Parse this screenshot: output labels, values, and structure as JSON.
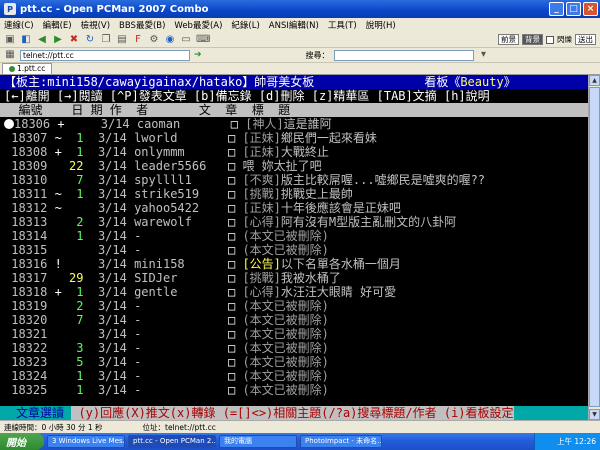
{
  "window": {
    "title": "ptt.cc - Open PCMan 2007 Combo"
  },
  "menu": [
    "連線(C)",
    "編輯(E)",
    "檢視(V)",
    "BBS最愛(B)",
    "Web最愛(A)",
    "紀錄(L)",
    "ANSI編輯(N)",
    "工具(T)",
    "說明(H)"
  ],
  "toolbar": {
    "btn1": "前景",
    "btn2": "背景",
    "checkbox_label": "閃爍",
    "select": "送出"
  },
  "address": {
    "value": "telnet://ptt.cc",
    "search_label": "搜尋："
  },
  "tab": {
    "label": "1.ptt.cc"
  },
  "terminal": {
    "header": {
      "left": "【板主:mini158/cawayigainax/hatako】",
      "board_title": "帥哥美女板",
      "right_prefix": "看板《",
      "board_name": "Beauty",
      "right_suffix": "》"
    },
    "hint": "[←]離開 [→]閱讀 [^P]發表文章 [b]備忘錄 [d]刪除 [z]精華區 [TAB]文摘 [h]說明",
    "columns": "  編號    日 期 作  者       文  章  標  題",
    "rows": [
      {
        "num": "18306",
        "mark": "+",
        "push": "",
        "date": "3/14",
        "author": "caoman",
        "cat": "[神人]",
        "title": "這是誰阿"
      },
      {
        "num": "18307",
        "mark": "~",
        "push": "1",
        "date": "3/14",
        "author": "lworld",
        "cat": "[正妹]",
        "title": "鄉民們一起來看妹"
      },
      {
        "num": "18308",
        "mark": "+",
        "push": "1",
        "date": "3/14",
        "author": "onlymmm",
        "cat": "[正妹]",
        "title": "大戰終止"
      },
      {
        "num": "18309",
        "mark": "",
        "push": "22",
        "date": "3/14",
        "author": "leader5566",
        "cat": "",
        "title": "喂 妳太扯了吧"
      },
      {
        "num": "18310",
        "mark": "",
        "push": "7",
        "date": "3/14",
        "author": "spyllll1",
        "cat": "[不爽]",
        "title": "版主比較屌喔...噓鄉民是噓爽的喔??"
      },
      {
        "num": "18311",
        "mark": "~",
        "push": "1",
        "date": "3/14",
        "author": "strike519",
        "cat": "[挑戰]",
        "title": "挑戰史上最帥"
      },
      {
        "num": "18312",
        "mark": "~",
        "push": "",
        "date": "3/14",
        "author": "yahoo5422",
        "cat": "[正妹]",
        "title": "十年後應該會是正妹吧"
      },
      {
        "num": "18313",
        "mark": "",
        "push": "2",
        "date": "3/14",
        "author": "warewolf",
        "cat": "[心得]",
        "title": "阿有沒有M型版主亂刪文的八卦阿"
      },
      {
        "num": "18314",
        "mark": "",
        "push": "1",
        "date": "3/14",
        "author": "-",
        "cat": "",
        "title": "(本文已被刪除)"
      },
      {
        "num": "18315",
        "mark": "",
        "push": "",
        "date": "3/14",
        "author": "-",
        "cat": "",
        "title": "(本文已被刪除)"
      },
      {
        "num": "18316",
        "mark": "!",
        "push": "",
        "date": "3/14",
        "author": "mini158",
        "cat": "[公告]",
        "title": "以下名單各水桶一個月"
      },
      {
        "num": "18317",
        "mark": "",
        "push": "29",
        "date": "3/14",
        "author": "SIDJer",
        "cat": "[挑戰]",
        "title": "我被水桶了"
      },
      {
        "num": "18318",
        "mark": "+",
        "push": "1",
        "date": "3/14",
        "author": "gentle",
        "cat": "[心得]",
        "title": "水汪汪大眼睛 好可愛"
      },
      {
        "num": "18319",
        "mark": "",
        "push": "2",
        "date": "3/14",
        "author": "-",
        "cat": "",
        "title": "(本文已被刪除)"
      },
      {
        "num": "18320",
        "mark": "",
        "push": "7",
        "date": "3/14",
        "author": "-",
        "cat": "",
        "title": "(本文已被刪除)"
      },
      {
        "num": "18321",
        "mark": "",
        "push": "",
        "date": "3/14",
        "author": "-",
        "cat": "",
        "title": "(本文已被刪除)"
      },
      {
        "num": "18322",
        "mark": "",
        "push": "3",
        "date": "3/14",
        "author": "-",
        "cat": "",
        "title": "(本文已被刪除)"
      },
      {
        "num": "18323",
        "mark": "",
        "push": "5",
        "date": "3/14",
        "author": "-",
        "cat": "",
        "title": "(本文已被刪除)"
      },
      {
        "num": "18324",
        "mark": "",
        "push": "1",
        "date": "3/14",
        "author": "-",
        "cat": "",
        "title": "(本文已被刪除)"
      },
      {
        "num": "18325",
        "mark": "",
        "push": "1",
        "date": "3/14",
        "author": "-",
        "cat": "",
        "title": "(本文已被刪除)"
      }
    ],
    "footer": {
      "lead": "文章選讀 ",
      "rest": " (y)回應(X)推文(x)轉錄 (=[]<>)相關主題(/?a)搜尋標題/作者 (i)看板設定"
    }
  },
  "status": {
    "connect_time": "連線時間：0 小時 30 分 1 秒",
    "address_label": "位址：telnet://ptt.cc"
  },
  "taskbar": {
    "start": "開始",
    "items": [
      "3 Windows Live Mes...",
      "ptt.cc - Open PCMan 2...",
      "我的電腦",
      "PhotoImpact - 未命名..."
    ],
    "clock": "上午 12:26"
  }
}
